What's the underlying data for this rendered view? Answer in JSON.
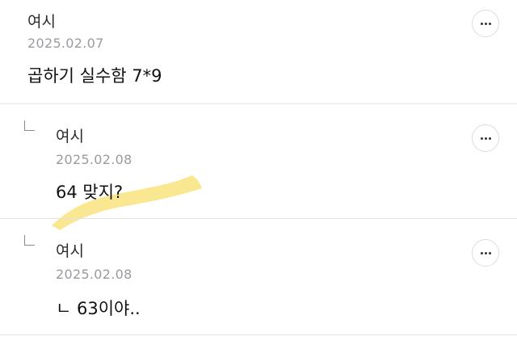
{
  "comments": [
    {
      "author": "여시",
      "date": "2025.02.07",
      "text": "곱하기 실수함 7*9"
    },
    {
      "author": "여시",
      "date": "2025.02.08",
      "text": "64 맞지?"
    },
    {
      "author": "여시",
      "date": "2025.02.08",
      "text": "ㄴ 63이야.."
    }
  ],
  "colors": {
    "highlight": "#f7df6e",
    "divider": "#e3e3e3",
    "date": "#9a9aa0"
  },
  "icons": {
    "more": "more-dots-icon",
    "reply": "reply-corner-icon"
  }
}
